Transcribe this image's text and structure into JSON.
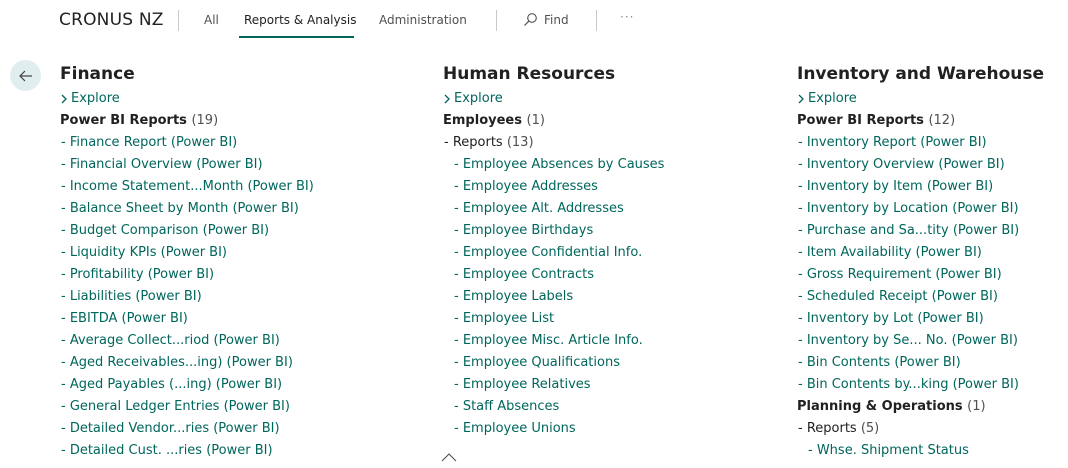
{
  "header": {
    "company": "CRONUS NZ",
    "tabs": [
      {
        "label": "All"
      },
      {
        "label": "Reports & Analysis"
      },
      {
        "label": "Administration"
      }
    ],
    "find_label": "Find",
    "more_label": "···"
  },
  "columns": {
    "finance": {
      "title": "Finance",
      "explore": "Explore",
      "group_title": "Power BI Reports",
      "group_count": "(19)",
      "links": [
        "- Finance Report (Power BI)",
        "- Financial Overview (Power BI)",
        "- Income Statement...Month (Power BI)",
        "- Balance Sheet by Month (Power BI)",
        "- Budget Comparison (Power BI)",
        "- Liquidity KPIs (Power BI)",
        "- Profitability (Power BI)",
        "- Liabilities (Power BI)",
        "- EBITDA (Power BI)",
        "- Average Collect...riod (Power BI)",
        "- Aged Receivables...ing) (Power BI)",
        "- Aged Payables (...ing) (Power BI)",
        "- General Ledger Entries (Power BI)",
        "- Detailed Vendor...ries (Power BI)",
        "- Detailed Cust. ...ries (Power BI)"
      ]
    },
    "hr": {
      "title": "Human Resources",
      "explore": "Explore",
      "group_title": "Employees",
      "group_count": "(1)",
      "sub_title": "- Reports",
      "sub_count": "(13)",
      "links": [
        "- Employee Absences by Causes",
        "- Employee Addresses",
        "- Employee Alt. Addresses",
        "- Employee Birthdays",
        "- Employee Confidential Info.",
        "- Employee Contracts",
        "- Employee Labels",
        "- Employee List",
        "- Employee Misc. Article Info.",
        "- Employee Qualifications",
        "- Employee Relatives",
        "- Staff Absences",
        "- Employee Unions"
      ]
    },
    "inventory": {
      "title": "Inventory and Warehouse",
      "explore": "Explore",
      "group_title": "Power BI Reports",
      "group_count": "(12)",
      "links": [
        "- Inventory Report (Power BI)",
        "- Inventory Overview (Power BI)",
        "- Inventory by Item (Power BI)",
        "- Inventory by Location (Power BI)",
        "- Purchase and Sa...tity (Power BI)",
        "- Item Availability (Power BI)",
        "- Gross Requirement (Power BI)",
        "- Scheduled Receipt (Power BI)",
        "- Inventory by Lot (Power BI)",
        "- Inventory by Se... No. (Power BI)",
        "- Bin Contents (Power BI)",
        "- Bin Contents by...king (Power BI)"
      ],
      "group2_title": "Planning & Operations",
      "group2_count": "(1)",
      "sub_title": "- Reports",
      "sub_count": "(5)",
      "links2": [
        "- Whse. Shipment Status"
      ]
    }
  },
  "colors": {
    "accent": "#00665c",
    "back_button_bg": "#e1eef0",
    "text": "#212121",
    "muted": "#505050"
  },
  "icons": {
    "back": "arrow-left-icon",
    "explore": "chevron-right-icon",
    "find": "search-icon",
    "collapse": "chevron-up-icon"
  }
}
